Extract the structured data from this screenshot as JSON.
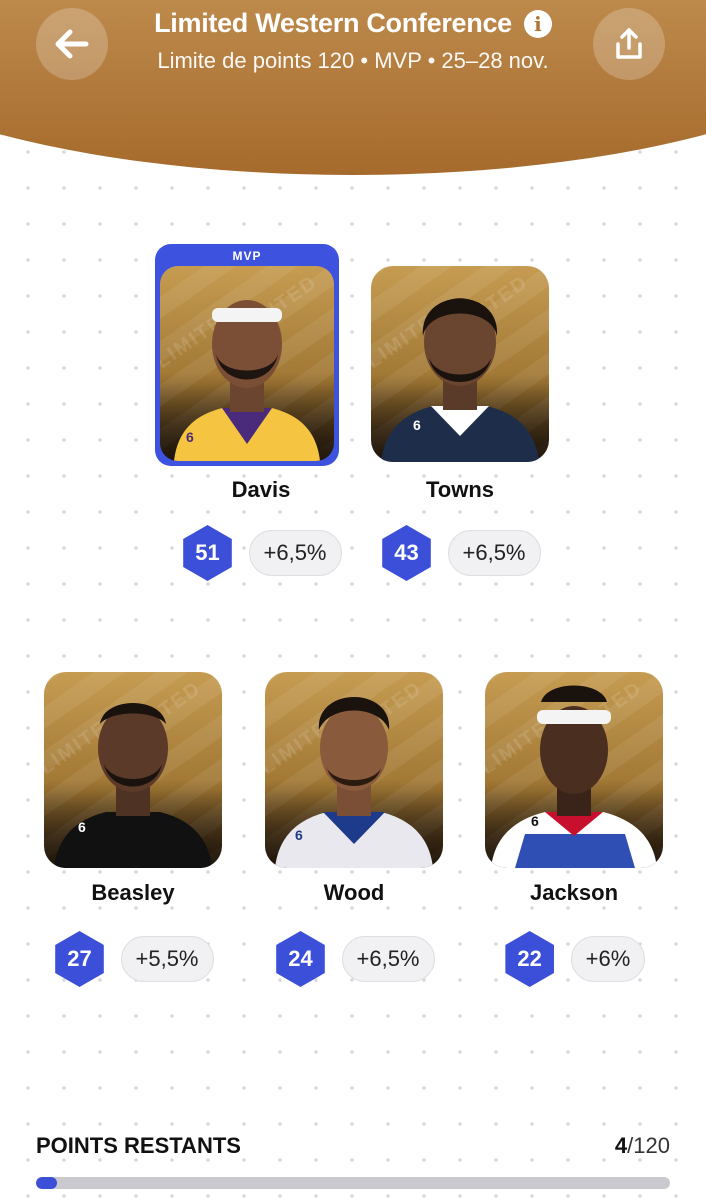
{
  "header": {
    "title": "Limited Western Conference",
    "subtitle": "Limite de points 120 • MVP • 25–28 nov.",
    "back_icon": "arrow-left-icon",
    "share_icon": "share-icon",
    "info_icon": "info-icon",
    "info_glyph": "i",
    "gradient_top": "#bd8a4c",
    "gradient_bottom": "#a56a2c"
  },
  "mvp_label": "MVP",
  "card_watermark": "LIMITED",
  "players": [
    {
      "name": "Davis",
      "score": "51",
      "bonus": "+6,5%",
      "is_mvp": true,
      "jersey": "#f5c542",
      "jersey_number": "6"
    },
    {
      "name": "Towns",
      "score": "43",
      "bonus": "+6,5%",
      "is_mvp": false,
      "jersey": "#1d2d4a",
      "jersey_number": "6"
    },
    {
      "name": "Beasley",
      "score": "27",
      "bonus": "+5,5%",
      "is_mvp": false,
      "jersey": "#111111",
      "jersey_number": "6"
    },
    {
      "name": "Wood",
      "score": "24",
      "bonus": "+6,5%",
      "is_mvp": false,
      "jersey": "#e8e8ee",
      "jersey_number": "6"
    },
    {
      "name": "Jackson",
      "score": "22",
      "bonus": "+6%",
      "is_mvp": false,
      "jersey": "#2f4fb5",
      "jersey_number": "6"
    }
  ],
  "footer": {
    "label": "POINTS RESTANTS",
    "remaining": "4",
    "total": "/120",
    "progress_fraction": 0.033
  },
  "colors": {
    "accent": "#3b4fd8",
    "mvp_frame": "#3d52de",
    "card_gold": "#c69c52"
  }
}
